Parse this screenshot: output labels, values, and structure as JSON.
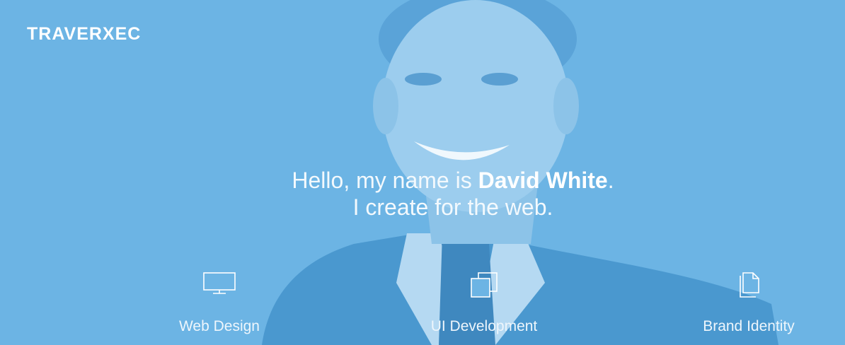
{
  "header": {
    "logo": "TRAVERXEC"
  },
  "hero": {
    "greeting_prefix": "Hello, my name is ",
    "name": "David White",
    "greeting_suffix": ".",
    "line2": "I create for the web."
  },
  "services": [
    {
      "label": "Web Design",
      "icon": "monitor-icon"
    },
    {
      "label": "UI Development",
      "icon": "stacked-windows-icon"
    },
    {
      "label": "Brand Identity",
      "icon": "documents-icon"
    }
  ],
  "colors": {
    "overlay": "#6cb4e4",
    "text": "#ffffff"
  }
}
